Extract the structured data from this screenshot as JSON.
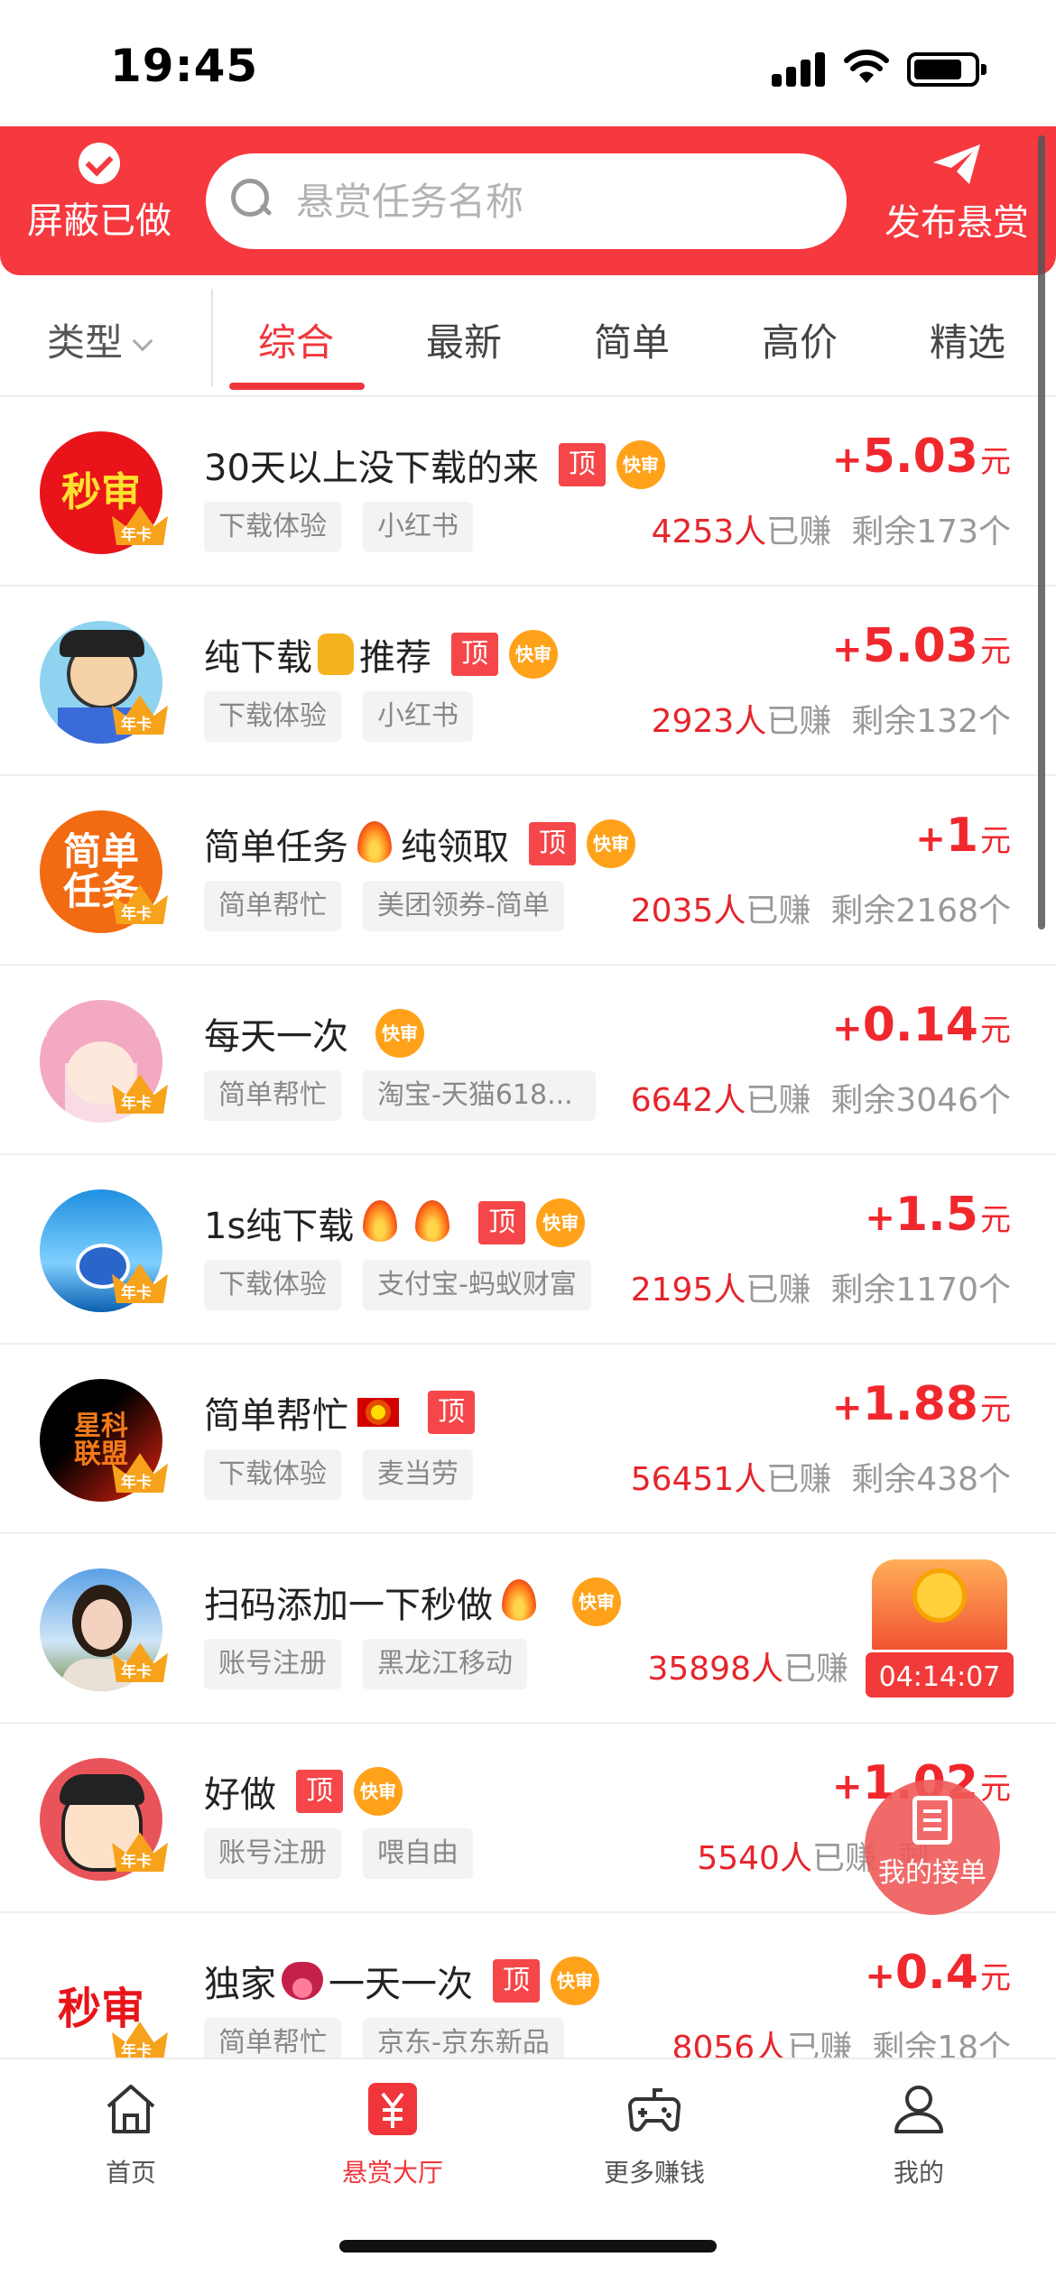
{
  "status_bar": {
    "time": "19:45"
  },
  "header": {
    "hide_done_label": "屏蔽已做",
    "search_placeholder": "悬赏任务名称",
    "publish_label": "发布悬赏"
  },
  "filter": {
    "type_label": "类型"
  },
  "tabs": [
    {
      "label": "综合",
      "active": true
    },
    {
      "label": "最新",
      "active": false
    },
    {
      "label": "简单",
      "active": false
    },
    {
      "label": "高价",
      "active": false
    },
    {
      "label": "精选",
      "active": false
    }
  ],
  "badges": {
    "top": "顶",
    "fast": "快审",
    "annual": "年卡"
  },
  "tasks": [
    {
      "title": "30天以上没下载的来",
      "emojis": [],
      "top": true,
      "fast": true,
      "avatar_text": "秒审",
      "tags": [
        "下载体验",
        "小红书"
      ],
      "reward_plus": "+",
      "reward": "5.03",
      "unit": "元",
      "earned_count": "4253人",
      "earned_label": "已赚",
      "remaining": "剩余173个"
    },
    {
      "title_a": "纯下载",
      "title_b": "推荐",
      "title": "纯下载推荐",
      "top": true,
      "fast": true,
      "tags": [
        "下载体验",
        "小红书"
      ],
      "reward_plus": "+",
      "reward": "5.03",
      "unit": "元",
      "earned_count": "2923人",
      "earned_label": "已赚",
      "remaining": "剩余132个"
    },
    {
      "title_a": "简单任务",
      "title_b": "纯领取",
      "title": "简单任务纯领取",
      "top": true,
      "fast": true,
      "avatar_text": "简单任务",
      "tags": [
        "简单帮忙",
        "美团领券-简单"
      ],
      "reward_plus": "+",
      "reward": "1",
      "unit": "元",
      "earned_count": "2035人",
      "earned_label": "已赚",
      "remaining": "剩余2168个"
    },
    {
      "title": "每天一次",
      "top": false,
      "fast": true,
      "tags": [
        "简单帮忙",
        "淘宝-天猫618..."
      ],
      "reward_plus": "+",
      "reward": "0.14",
      "unit": "元",
      "earned_count": "6642人",
      "earned_label": "已赚",
      "remaining": "剩余3046个"
    },
    {
      "title": "1s纯下载",
      "top": true,
      "fast": true,
      "tags": [
        "下载体验",
        "支付宝-蚂蚁财富"
      ],
      "reward_plus": "+",
      "reward": "1.5",
      "unit": "元",
      "earned_count": "2195人",
      "earned_label": "已赚",
      "remaining": "剩余1170个"
    },
    {
      "title": "简单帮忙",
      "top": true,
      "fast": false,
      "avatar_text": "星科联盟",
      "tags": [
        "下载体验",
        "麦当劳"
      ],
      "reward_plus": "+",
      "reward": "1.88",
      "unit": "元",
      "earned_count": "56451人",
      "earned_label": "已赚",
      "remaining": "剩余438个"
    },
    {
      "title": "扫码添加一下秒做",
      "top": false,
      "fast": true,
      "tags": [
        "账号注册",
        "黑龙江移动"
      ],
      "reward_plus": "",
      "reward": "",
      "unit": "",
      "earned_count": "35898人",
      "earned_label": "已赚",
      "remaining": ""
    },
    {
      "title": "好做",
      "top": true,
      "fast": true,
      "tags": [
        "账号注册",
        "喂自由"
      ],
      "reward_plus": "+",
      "reward": "1.02",
      "unit": "元",
      "earned_count": "5540人",
      "earned_label": "已赚",
      "remaining": "剩"
    },
    {
      "title_a": "独家",
      "title_b": "一天一次",
      "title": "独家一天一次",
      "top": true,
      "fast": true,
      "avatar_text": "秒审",
      "tags": [
        "简单帮忙",
        "京东-京东新品"
      ],
      "reward_plus": "+",
      "reward": "0.4",
      "unit": "元",
      "earned_count": "8056人",
      "earned_label": "已赚",
      "remaining": "剩余18个"
    }
  ],
  "red_packet": {
    "timer": "04:14:07"
  },
  "floating": {
    "my_orders_label": "我的接单"
  },
  "tab_bar": [
    {
      "label": "首页",
      "icon": "home-icon",
      "active": false
    },
    {
      "label": "悬赏大厅",
      "icon": "yuan-icon",
      "active": true
    },
    {
      "label": "更多赚钱",
      "icon": "gamepad-icon",
      "active": false
    },
    {
      "label": "我的",
      "icon": "user-icon",
      "active": false
    }
  ],
  "colors": {
    "brand_red": "#f6383f",
    "reward_red": "#f0282e",
    "fast_badge": "#ffa21a"
  }
}
